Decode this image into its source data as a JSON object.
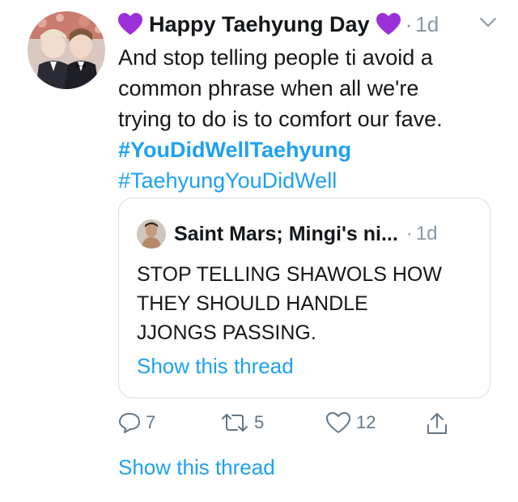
{
  "tweet": {
    "author": "Happy Taehyung Day",
    "separator": "·",
    "timestamp": "1d",
    "text_lines": [
      "And stop telling people ti avoid a",
      "common phrase when all we're",
      "trying to do is to comfort our fave."
    ],
    "hashtags": [
      "#YouDidWellTaehyung",
      "#TaehyungYouDidWell"
    ],
    "icons": {
      "name_left": "purple-heart-icon",
      "name_right": "purple-heart-icon",
      "menu": "chevron-down-icon"
    }
  },
  "quoted_tweet": {
    "author": "Saint Mars; Mingi's ni...",
    "separator": "·",
    "timestamp": "1d",
    "text_lines": [
      "STOP TELLING SHAWOLS HOW",
      "THEY SHOULD HANDLE",
      "JJONGS PASSING."
    ],
    "show_thread_label": "Show this thread"
  },
  "actions": {
    "reply_count": "7",
    "retweet_count": "5",
    "like_count": "12",
    "icons": [
      "reply-icon",
      "retweet-icon",
      "like-icon",
      "share-icon"
    ]
  },
  "footer": {
    "show_thread_label": "Show this thread"
  },
  "colors": {
    "link": "#1da1f2",
    "meta": "#8899a6",
    "text": "#14171a",
    "heart": "#9b30d9",
    "border": "#d6dde3"
  }
}
